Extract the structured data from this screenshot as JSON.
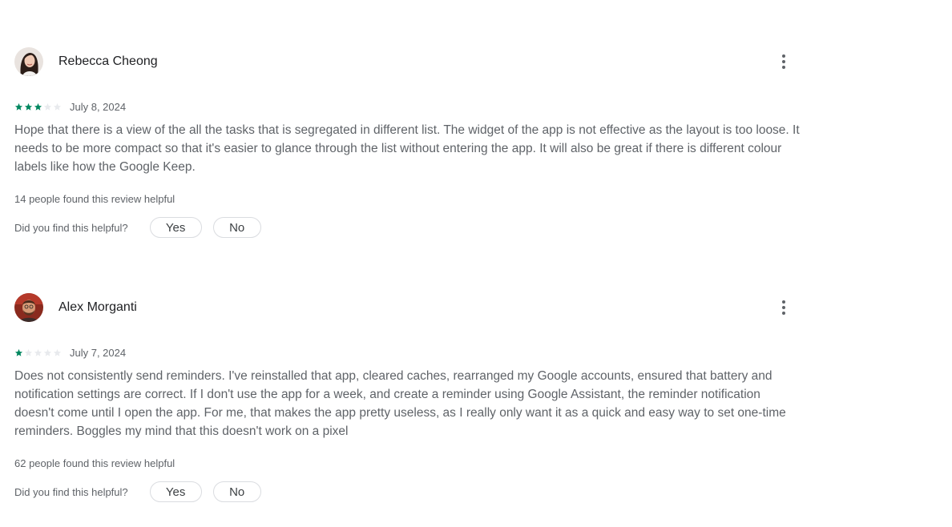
{
  "colors": {
    "star_filled": "#01875f",
    "star_empty": "#e8eaed",
    "text_primary": "#202124",
    "text_secondary": "#5f6368"
  },
  "reviews": [
    {
      "author": "Rebecca Cheong",
      "avatar_icon": "avatar-photo-woman",
      "rating": 3,
      "rating_max": 5,
      "date": "July 8, 2024",
      "text": "Hope that there is a view of the all the tasks that is segregated in different list. The widget of the app is not effective as the layout is too loose. It needs to be more compact so that it's easier to glance through the list without entering the app. It will also be great if there is different colour labels like how the Google Keep.",
      "helpful_count": "14 people found this review helpful",
      "helpful_prompt": "Did you find this helpful?",
      "yes_label": "Yes",
      "no_label": "No",
      "more_icon": "more-vert-icon"
    },
    {
      "author": "Alex Morganti",
      "avatar_icon": "avatar-photo-man",
      "rating": 1,
      "rating_max": 5,
      "date": "July 7, 2024",
      "text": "Does not consistently send reminders. I've reinstalled that app, cleared caches, rearranged my Google accounts, ensured that battery and notification settings are correct. If I don't use the app for a week, and create a reminder using Google Assistant, the reminder notification doesn't come until I open the app. For me, that makes the app pretty useless, as I really only want it as a quick and easy way to set one-time reminders. Boggles my mind that this doesn't work on a pixel",
      "helpful_count": "62 people found this review helpful",
      "helpful_prompt": "Did you find this helpful?",
      "yes_label": "Yes",
      "no_label": "No",
      "more_icon": "more-vert-icon"
    }
  ]
}
